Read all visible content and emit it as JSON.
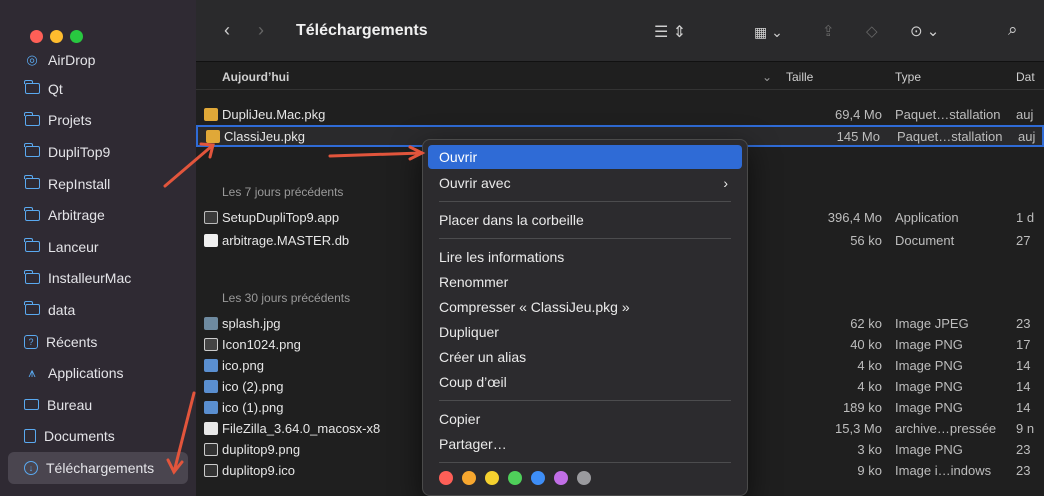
{
  "window": {
    "title": "Téléchargements",
    "traffic_colors": [
      "#fe5f57",
      "#febc2e",
      "#28c840"
    ]
  },
  "sidebar": {
    "items": [
      {
        "label": "AirDrop",
        "icon": "airdrop-icon"
      },
      {
        "label": "Qt",
        "icon": "folder-icon"
      },
      {
        "label": "Projets",
        "icon": "folder-icon"
      },
      {
        "label": "DupliTop9",
        "icon": "folder-icon"
      },
      {
        "label": "RepInstall",
        "icon": "folder-icon"
      },
      {
        "label": "Arbitrage",
        "icon": "folder-icon"
      },
      {
        "label": "Lanceur",
        "icon": "folder-icon"
      },
      {
        "label": "InstalleurMac",
        "icon": "folder-icon"
      },
      {
        "label": "data",
        "icon": "folder-icon"
      },
      {
        "label": "Récents",
        "icon": "recents-icon"
      },
      {
        "label": "Applications",
        "icon": "applications-icon"
      },
      {
        "label": "Bureau",
        "icon": "desktop-icon"
      },
      {
        "label": "Documents",
        "icon": "document-icon"
      },
      {
        "label": "Téléchargements",
        "icon": "download-icon"
      }
    ]
  },
  "columns": {
    "name": "Aujourd’hui",
    "size": "Taille",
    "type": "Type",
    "date": "Dat"
  },
  "groups": {
    "last7": "Les 7 jours précédents",
    "last30": "Les 30 jours précédents"
  },
  "files": {
    "today": [
      {
        "name": "DupliJeu.Mac.pkg",
        "size": "69,4 Mo",
        "type": "Paquet…stallation",
        "date": "auj"
      },
      {
        "name": "ClassiJeu.pkg",
        "size": "145 Mo",
        "type": "Paquet…stallation",
        "date": "auj"
      }
    ],
    "week": [
      {
        "name": "SetupDupliTop9.app",
        "size": "396,4 Mo",
        "type": "Application",
        "date": "1 d"
      },
      {
        "name": "arbitrage.MASTER.db",
        "size": "56 ko",
        "type": "Document",
        "date": "27"
      }
    ],
    "month": [
      {
        "name": "splash.jpg",
        "size": "62 ko",
        "type": "Image JPEG",
        "date": "23"
      },
      {
        "name": "Icon1024.png",
        "size": "40 ko",
        "type": "Image PNG",
        "date": "17"
      },
      {
        "name": "ico.png",
        "size": "4 ko",
        "type": "Image PNG",
        "date": "14"
      },
      {
        "name": "ico (2).png",
        "size": "4 ko",
        "type": "Image PNG",
        "date": "14"
      },
      {
        "name": "ico (1).png",
        "size": "189 ko",
        "type": "Image PNG",
        "date": "14"
      },
      {
        "name": "FileZilla_3.64.0_macosx-x8",
        "size": "15,3 Mo",
        "type": "archive…pressée",
        "date": "9 n"
      },
      {
        "name": "duplitop9.png",
        "size": "3 ko",
        "type": "Image PNG",
        "date": "23"
      },
      {
        "name": "duplitop9.ico",
        "size": "9 ko",
        "type": "Image i…indows",
        "date": "23"
      }
    ]
  },
  "context_menu": {
    "open": "Ouvrir",
    "open_with": "Ouvrir avec",
    "trash": "Placer dans la corbeille",
    "info": "Lire les informations",
    "rename": "Renommer",
    "compress": "Compresser « ClassiJeu.pkg »",
    "duplicate": "Dupliquer",
    "alias": "Créer un alias",
    "quicklook": "Coup d’œil",
    "copy": "Copier",
    "share": "Partager…",
    "tag_colors": [
      "#fe5f57",
      "#f7a72f",
      "#f5d12f",
      "#4fd05a",
      "#3e8ef7",
      "#c16ee6",
      "#9a9a9e"
    ]
  },
  "accent_color": "#2f6bd6",
  "arrow_color": "#e2553c"
}
